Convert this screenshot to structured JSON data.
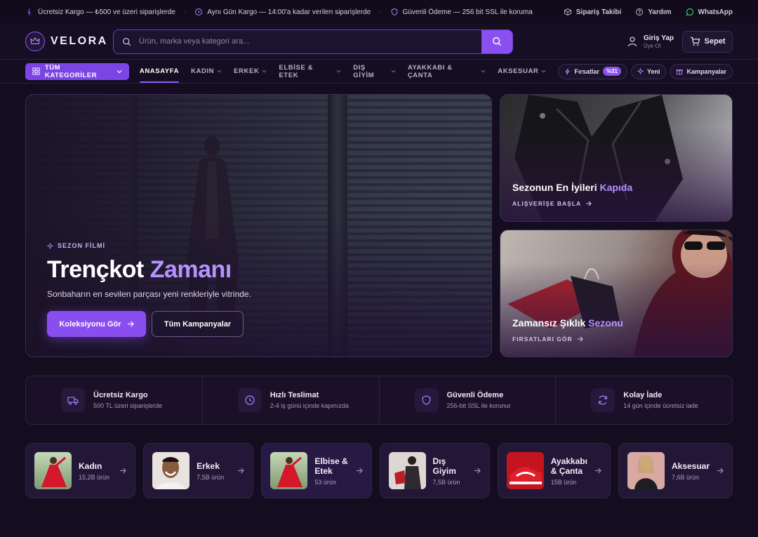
{
  "topbar": {
    "left": [
      {
        "text": "Ücretsiz Kargo — ₺500 ve üzeri siparişlerde",
        "icon": "truck-icon"
      },
      {
        "text": "Aynı Gün Kargo — 14:00'a kadar verilen siparişlerde",
        "icon": "clock-icon"
      },
      {
        "text": "Güvenli Ödeme — 256 bit SSL ile koruma",
        "icon": "shield-icon"
      }
    ],
    "right": [
      {
        "text": "Sipariş Takibi",
        "icon": "box-icon"
      },
      {
        "text": "Yardım",
        "icon": "help-icon"
      },
      {
        "text": "WhatsApp",
        "icon": "chat-icon"
      }
    ]
  },
  "header": {
    "brand": "VELORA",
    "search_placeholder": "Ürün, marka veya kategori ara...",
    "login_title": "Giriş Yap",
    "login_sub": "Üye Ol",
    "cart_label": "Sepet"
  },
  "nav": {
    "all_categories": "TÜM KATEGORİLER",
    "items": [
      {
        "label": "ANASAYFA",
        "active": true
      },
      {
        "label": "KADIN"
      },
      {
        "label": "ERKEK"
      },
      {
        "label": "ELBİSE & ETEK"
      },
      {
        "label": "DIŞ GİYİM"
      },
      {
        "label": "AYAKKABI & ÇANTA"
      },
      {
        "label": "AKSESUAR"
      }
    ],
    "deals_label": "Fırsatlar",
    "deals_badge": "%31",
    "new_label": "Yeni",
    "campaigns_label": "Kampanyalar"
  },
  "hero": {
    "eyebrow": "SEZON FİLMİ",
    "title_a": "Trençkot ",
    "title_b": "Zamanı",
    "subtitle": "Sonbaharın en sevilen parçası yeni renkleriyle vitrinde.",
    "primary_btn": "Koleksiyonu Gör",
    "secondary_btn": "Tüm Kampanyalar"
  },
  "side_cards": [
    {
      "title_a": "Sezonun En İyileri ",
      "title_b": "Kapıda",
      "link": "ALIŞVERİŞE BAŞLA"
    },
    {
      "title_a": "Zamansız Şıklık ",
      "title_b": "Sezonu",
      "link": "FIRSATLARI GÖR"
    }
  ],
  "features": [
    {
      "title": "Ücretsiz Kargo",
      "sub": "500 TL üzeri siparişlerde",
      "icon": "truck-icon"
    },
    {
      "title": "Hızlı Teslimat",
      "sub": "2-4 iş günü içinde kapınızda",
      "icon": "clock-icon"
    },
    {
      "title": "Güvenli Ödeme",
      "sub": "256-bit SSL ile korunur",
      "icon": "shield-icon"
    },
    {
      "title": "Kolay İade",
      "sub": "14 gün içinde ücretsiz iade",
      "icon": "refresh-icon"
    }
  ],
  "categories": [
    {
      "name": "Kadın",
      "count": "15,2B ürün"
    },
    {
      "name": "Erkek",
      "count": "7,5B ürün"
    },
    {
      "name": "Elbise & Etek",
      "count": "53 ürün"
    },
    {
      "name": "Dış Giyim",
      "count": "7,5B ürün"
    },
    {
      "name": "Ayakkabı & Çanta",
      "count": "15B ürün"
    },
    {
      "name": "Aksesuar",
      "count": "7,6B ürün"
    }
  ],
  "colors": {
    "accent": "#8b4ff0",
    "accent_light": "#b692ff",
    "bg": "#140d1f"
  }
}
